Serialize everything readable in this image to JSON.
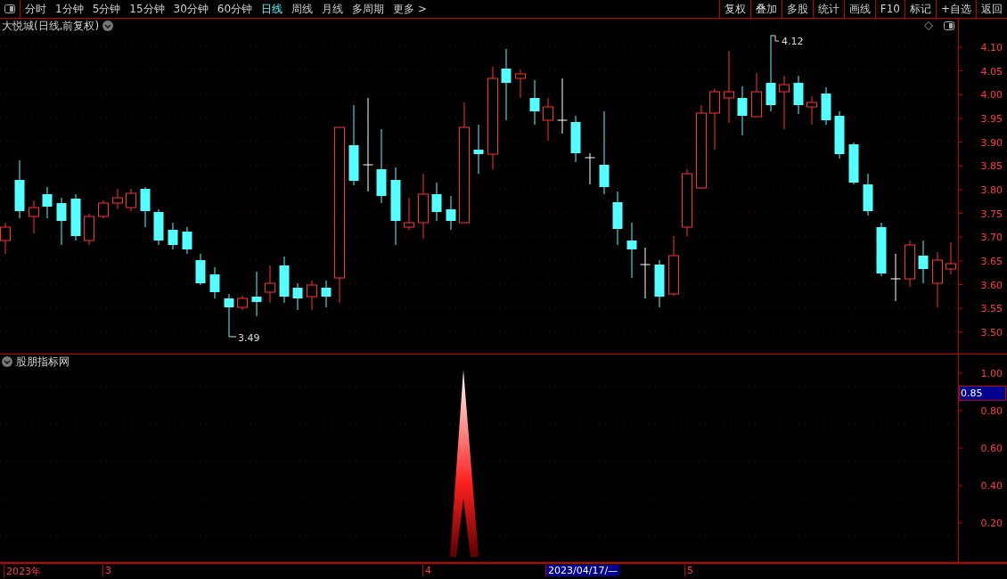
{
  "toolbar": {
    "period_tabs": [
      {
        "label": "分时",
        "selected": false
      },
      {
        "label": "1分钟",
        "selected": false
      },
      {
        "label": "5分钟",
        "selected": false
      },
      {
        "label": "15分钟",
        "selected": false
      },
      {
        "label": "30分钟",
        "selected": false
      },
      {
        "label": "60分钟",
        "selected": false
      },
      {
        "label": "日线",
        "selected": true
      },
      {
        "label": "周线",
        "selected": false
      },
      {
        "label": "月线",
        "selected": false
      },
      {
        "label": "多周期",
        "selected": false
      },
      {
        "label": "更多 >",
        "selected": false
      }
    ],
    "buttons": [
      "复权",
      "叠加",
      "多股",
      "统计",
      "画线",
      "F10",
      "标记",
      "+自选",
      "返回"
    ]
  },
  "price_chart": {
    "title": "大悦城(日线,前复权)",
    "high_label": "4.12",
    "low_label": "3.49",
    "axis_labels": [
      "4.10",
      "4.05",
      "4.00",
      "3.95",
      "3.90",
      "3.85",
      "3.80",
      "3.75",
      "3.70",
      "3.65",
      "3.60",
      "3.55",
      "3.50"
    ]
  },
  "indicator": {
    "title": "股朋指标网",
    "current_value": "0.85",
    "axis_labels": [
      "1.00",
      "0.80",
      "0.60",
      "0.40",
      "0.20"
    ]
  },
  "date_axis": [
    {
      "label": "2023年",
      "kind": "tick"
    },
    {
      "label": "3",
      "kind": "tick"
    },
    {
      "label": "4",
      "kind": "tick"
    },
    {
      "label": "2023/04/17/—",
      "kind": "cursor"
    },
    {
      "label": "5",
      "kind": "tick"
    }
  ]
}
